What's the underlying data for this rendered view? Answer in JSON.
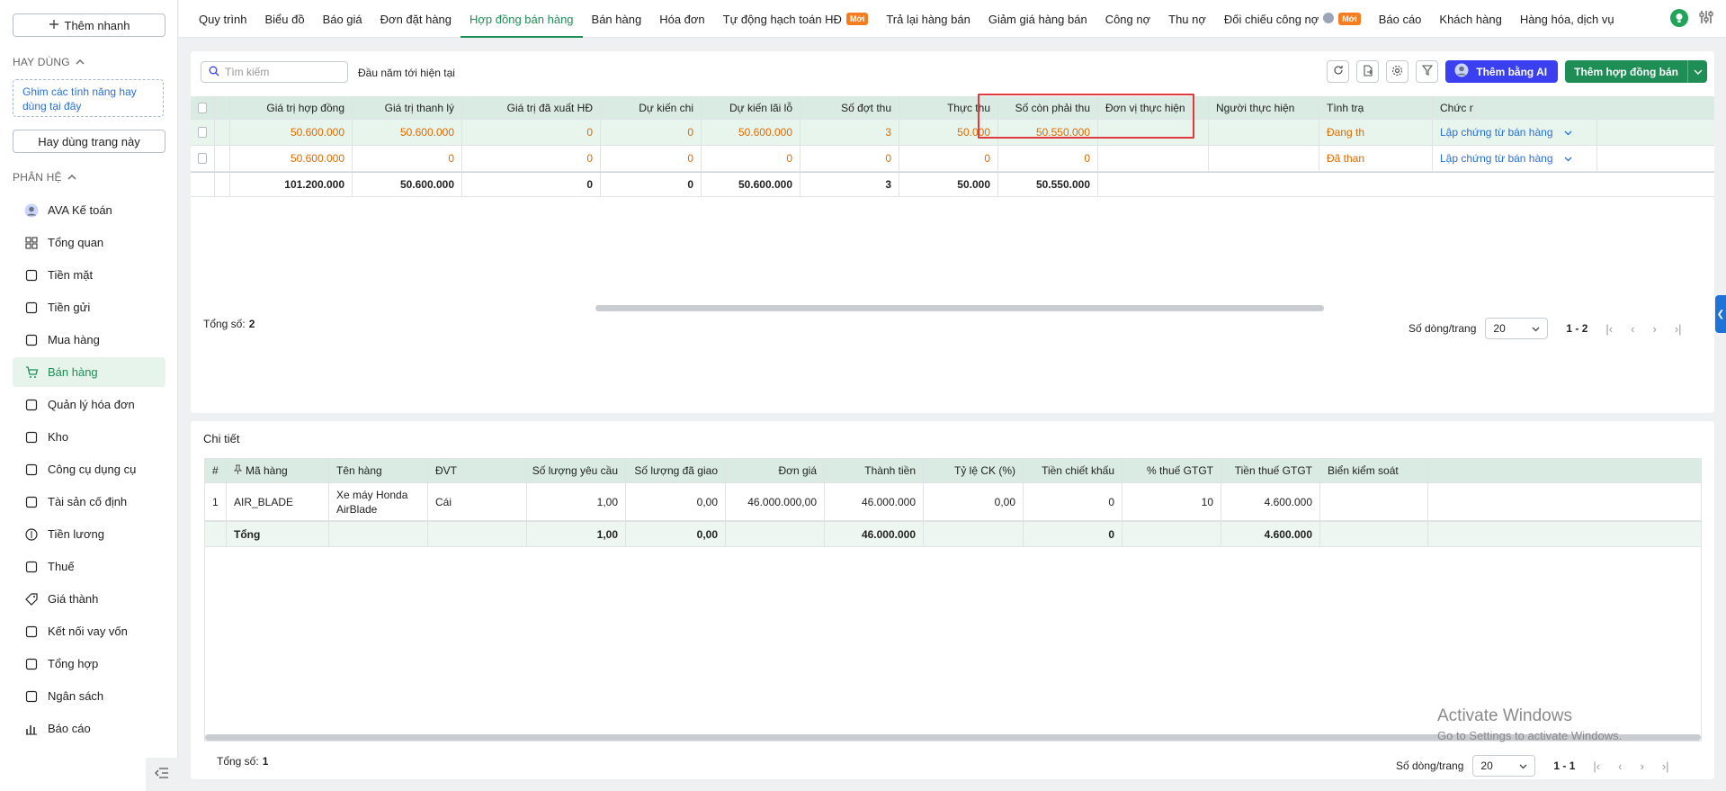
{
  "sidebar": {
    "quick_add": "Thêm nhanh",
    "favorites_title": "HAY DÙNG",
    "pin_hint": "Ghim các tính năng hay dùng tại đây",
    "pin_page": "Hay dùng trang này",
    "modules_title": "PHÂN HỆ",
    "items": [
      {
        "label": "AVA Kế toán",
        "icon": "ava-avatar-icon"
      },
      {
        "label": "Tổng quan",
        "icon": "dashboard-icon"
      },
      {
        "label": "Tiền mặt",
        "icon": "cash-icon"
      },
      {
        "label": "Tiền gửi",
        "icon": "bank-icon"
      },
      {
        "label": "Mua hàng",
        "icon": "shopping-bag-icon"
      },
      {
        "label": "Bán hàng",
        "icon": "cart-icon"
      },
      {
        "label": "Quản lý hóa đơn",
        "icon": "invoice-icon"
      },
      {
        "label": "Kho",
        "icon": "warehouse-icon"
      },
      {
        "label": "Công cụ dụng cụ",
        "icon": "tools-icon"
      },
      {
        "label": "Tài sản cố định",
        "icon": "car-icon"
      },
      {
        "label": "Tiền lương",
        "icon": "salary-icon"
      },
      {
        "label": "Thuế",
        "icon": "tax-icon"
      },
      {
        "label": "Giá thành",
        "icon": "price-tag-icon"
      },
      {
        "label": "Kết nối vay vốn",
        "icon": "network-icon"
      },
      {
        "label": "Tổng hợp",
        "icon": "book-icon"
      },
      {
        "label": "Ngân sách",
        "icon": "budget-icon"
      },
      {
        "label": "Báo cáo",
        "icon": "report-chart-icon"
      }
    ]
  },
  "tabs": [
    {
      "label": "Quy trình"
    },
    {
      "label": "Biểu đồ"
    },
    {
      "label": "Báo giá"
    },
    {
      "label": "Đơn đặt hàng"
    },
    {
      "label": "Hợp đồng bán hàng"
    },
    {
      "label": "Bán hàng"
    },
    {
      "label": "Hóa đơn"
    },
    {
      "label": "Tự động hạch toán HĐ",
      "badge": "Mới"
    },
    {
      "label": "Trả lại hàng bán"
    },
    {
      "label": "Giảm giá hàng bán"
    },
    {
      "label": "Công nợ"
    },
    {
      "label": "Thu nợ"
    },
    {
      "label": "Đối chiếu công nợ",
      "badge": "Mới"
    },
    {
      "label": "Báo cáo"
    },
    {
      "label": "Khách hàng"
    },
    {
      "label": "Hàng hóa, dịch vụ"
    }
  ],
  "toolbar": {
    "search_placeholder": "Tìm kiếm",
    "period": "Đầu năm tới hiện tại",
    "ai_button": "Thêm bằng AI",
    "add_button": "Thêm hợp đồng bán"
  },
  "contracts": {
    "headers": [
      "Giá trị hợp đồng",
      "Giá trị thanh lý",
      "Giá trị đã xuất HĐ",
      "Dự kiến chi",
      "Dự kiến lãi lỗ",
      "Số đợt thu",
      "Thực thu",
      "Số còn phải thu",
      "Đơn vị thực hiện",
      "Người thực hiện",
      "Tình trạ",
      "Chức năng"
    ],
    "rows": [
      {
        "cells": [
          "50.600.000",
          "50.600.000",
          "0",
          "0",
          "50.600.000",
          "3",
          "50.000",
          "50.550.000",
          "",
          "",
          "Đang th"
        ],
        "action": "Lập chứng từ bán hàng"
      },
      {
        "cells": [
          "50.600.000",
          "0",
          "0",
          "0",
          "0",
          "0",
          "0",
          "0",
          "",
          "",
          "Đã than"
        ],
        "action": "Lập chứng từ bán hàng"
      }
    ],
    "totals": [
      "101.200.000",
      "50.600.000",
      "0",
      "0",
      "50.600.000",
      "3",
      "50.000",
      "50.550.000"
    ],
    "total_label": "Tổng số:",
    "total_count": "2",
    "rows_per_page_label": "Số dòng/trang",
    "rows_per_page": "20",
    "range": "1 - 2"
  },
  "detail": {
    "title": "Chi tiết",
    "headers": [
      "#",
      "Mã hàng",
      "Tên hàng",
      "ĐVT",
      "Số lượng yêu cầu",
      "Số lượng đã giao",
      "Đơn giá",
      "Thành tiền",
      "Tỷ lệ CK (%)",
      "Tiền chiết khấu",
      "% thuế GTGT",
      "Tiền thuế GTGT",
      "Biển kiểm soát"
    ],
    "rows": [
      [
        "1",
        "AIR_BLADE",
        "Xe máy Honda AirBlade",
        "Cái",
        "1,00",
        "0,00",
        "46.000.000,00",
        "46.000.000",
        "0,00",
        "0",
        "10",
        "4.600.000",
        ""
      ]
    ],
    "totals": {
      "label": "Tổng",
      "qty_req": "1,00",
      "qty_del": "0,00",
      "amount": "46.000.000",
      "discount": "0",
      "vat": "4.600.000"
    },
    "total_label": "Tổng số:",
    "total_count": "1",
    "rows_per_page_label": "Số dòng/trang",
    "rows_per_page": "20",
    "range": "1 - 1"
  },
  "watermark": {
    "line1": "Activate Windows",
    "line2": "Go to Settings to activate Windows."
  },
  "colors": {
    "brand_green": "#1e8e56",
    "accent_orange": "#e06a00",
    "link_blue": "#2a6fd6",
    "highlight_red": "#e0393e",
    "ai_blue": "#3a3ff0"
  }
}
